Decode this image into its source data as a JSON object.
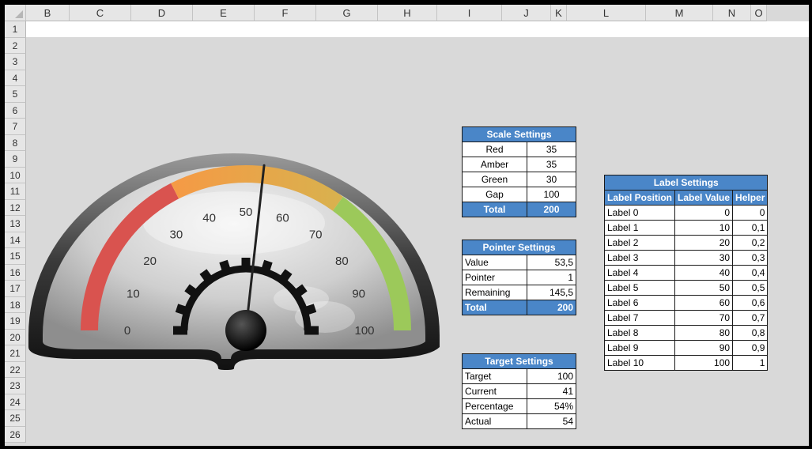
{
  "columns": [
    "B",
    "C",
    "D",
    "E",
    "F",
    "G",
    "H",
    "I",
    "J",
    "K",
    "L",
    "M",
    "N",
    "O"
  ],
  "rows": [
    "1",
    "2",
    "3",
    "4",
    "5",
    "6",
    "7",
    "8",
    "9",
    "10",
    "11",
    "12",
    "13",
    "14",
    "15",
    "16",
    "17",
    "18",
    "19",
    "20",
    "21",
    "22",
    "23",
    "24",
    "25",
    "26"
  ],
  "scale_settings": {
    "title": "Scale Settings",
    "rows": [
      [
        "Red",
        "35"
      ],
      [
        "Amber",
        "35"
      ],
      [
        "Green",
        "30"
      ],
      [
        "Gap",
        "100"
      ]
    ],
    "total": [
      "Total",
      "200"
    ]
  },
  "pointer_settings": {
    "title": "Pointer Settings",
    "rows": [
      [
        "Value",
        "53,5"
      ],
      [
        "Pointer",
        "1"
      ],
      [
        "Remaining",
        "145,5"
      ]
    ],
    "total": [
      "Total",
      "200"
    ]
  },
  "target_settings": {
    "title": "Target Settings",
    "rows": [
      [
        "Target",
        "100"
      ],
      [
        "Current",
        "41"
      ],
      [
        "Percentage",
        "54%"
      ],
      [
        "Actual",
        "54"
      ]
    ]
  },
  "label_settings": {
    "title": "Label Settings",
    "headers": [
      "Label Position",
      "Label Value",
      "Helper"
    ],
    "rows": [
      [
        "Label 0",
        "0",
        "0"
      ],
      [
        "Label 1",
        "10",
        "0,1"
      ],
      [
        "Label 2",
        "20",
        "0,2"
      ],
      [
        "Label 3",
        "30",
        "0,3"
      ],
      [
        "Label 4",
        "40",
        "0,4"
      ],
      [
        "Label 5",
        "50",
        "0,5"
      ],
      [
        "Label 6",
        "60",
        "0,6"
      ],
      [
        "Label 7",
        "70",
        "0,7"
      ],
      [
        "Label 8",
        "80",
        "0,8"
      ],
      [
        "Label 9",
        "90",
        "0,9"
      ],
      [
        "Label 10",
        "100",
        "1"
      ]
    ]
  },
  "gauge": {
    "labels": [
      "0",
      "10",
      "20",
      "30",
      "40",
      "50",
      "60",
      "70",
      "80",
      "90",
      "100"
    ],
    "value": 53.5,
    "max": 100,
    "bands": [
      {
        "name": "red",
        "to": 35,
        "color": "#d9534f"
      },
      {
        "name": "amber",
        "to": 70,
        "color": "#f7a24a"
      },
      {
        "name": "green",
        "to": 100,
        "color": "#9cc95a"
      }
    ]
  }
}
